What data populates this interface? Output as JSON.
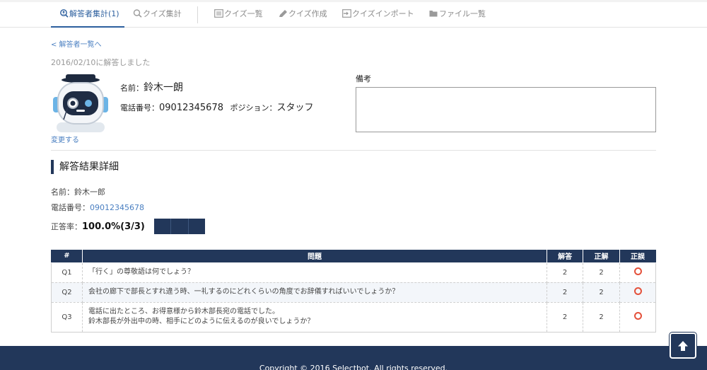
{
  "nav": {
    "tabs": [
      {
        "label": "解答者集計(1)",
        "icon": "user-search-icon",
        "active": true
      },
      {
        "label": "クイズ集計",
        "icon": "search-icon",
        "active": false
      },
      {
        "label": "クイズ一覧",
        "icon": "list-icon",
        "active": false
      },
      {
        "label": "クイズ作成",
        "icon": "pencil-icon",
        "active": false
      },
      {
        "label": "クイズインポート",
        "icon": "import-icon",
        "active": false
      },
      {
        "label": "ファイル一覧",
        "icon": "folder-icon",
        "active": false
      }
    ]
  },
  "back_link": "< 解答者一覧へ",
  "answered_date": "2016/02/10に解答しました",
  "profile": {
    "change_link": "変更する",
    "name_label": "名前：",
    "name": "鈴木一朗",
    "phone_label": "電話番号：",
    "phone": "09012345678",
    "position_label": "ポジション：",
    "position": "スタッフ"
  },
  "memo": {
    "label": "備考",
    "value": ""
  },
  "details": {
    "title": "解答結果詳細",
    "name_label": "名前：",
    "name": "鈴木一郎",
    "phone_label": "電話番号：",
    "phone": "09012345678",
    "rate_label": "正答率：",
    "rate": "100.0%(3/3)",
    "rate_fraction": 1.0
  },
  "table": {
    "headers": [
      "#",
      "問題",
      "解答",
      "正解",
      "正誤"
    ],
    "rows": [
      {
        "no": "Q1",
        "question": "「行く」の尊敬語は何でしょう？",
        "answer": "2",
        "correct": "2",
        "result": "correct-circle-icon"
      },
      {
        "no": "Q2",
        "question": "会社の廊下で部長とすれ違う時、一礼するのにどれくらいの角度でお辞儀すればいいでしょうか？",
        "answer": "2",
        "correct": "2",
        "result": "correct-circle-icon"
      },
      {
        "no": "Q3",
        "question_lines": [
          "電話に出たところ、お得意様から鈴木部長宛の電話でした。",
          "鈴木部長が外出中の時、相手にどのように伝えるのが良いでしょうか？"
        ],
        "answer": "2",
        "correct": "2",
        "result": "correct-circle-icon"
      }
    ]
  },
  "footer": {
    "copyright": "Copyright © 2016 Selectbot. All rights reserved."
  },
  "colors": {
    "primary": "#22375a",
    "link": "#4a7fc1",
    "correct": "#e4513b"
  }
}
